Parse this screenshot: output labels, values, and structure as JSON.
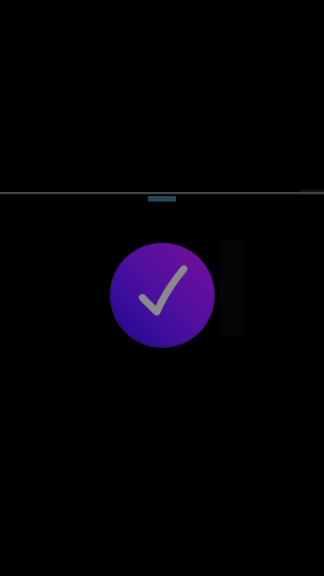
{
  "screen": {
    "background": "#000000"
  },
  "divider": {
    "color": "#4a4a4a"
  },
  "drag_handle": {
    "color": "#2a4e66"
  },
  "success_badge": {
    "icon": "checkmark-icon",
    "gradient_start": "#1a0a8c",
    "gradient_end": "#7a0f9a",
    "check_color": "#8a8a8a"
  }
}
